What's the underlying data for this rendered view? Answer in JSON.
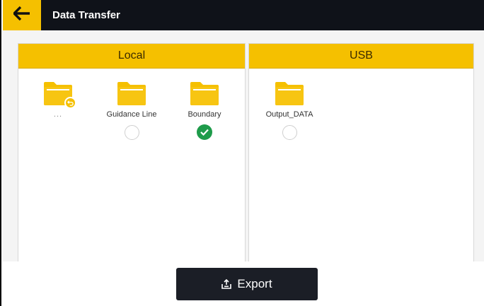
{
  "header": {
    "title": "Data Transfer",
    "back_icon": "arrow-left-icon"
  },
  "colors": {
    "accent": "#f5c000",
    "header_bg": "#0f1219",
    "check": "#1e9b4a",
    "button_bg": "#1b1e26"
  },
  "local": {
    "title": "Local",
    "items": [
      {
        "label": "...",
        "icon": "folder-return-icon",
        "selector": "none"
      },
      {
        "label": "Guidance Line",
        "icon": "folder-icon",
        "selector": "radio",
        "selected": false
      },
      {
        "label": "Boundary",
        "icon": "folder-icon",
        "selector": "radio",
        "selected": true
      }
    ]
  },
  "usb": {
    "title": "USB",
    "items": [
      {
        "label": "Output_DATA",
        "icon": "folder-icon",
        "selector": "radio",
        "selected": false
      }
    ]
  },
  "footer": {
    "export_label": "Export",
    "export_icon": "export-icon"
  }
}
